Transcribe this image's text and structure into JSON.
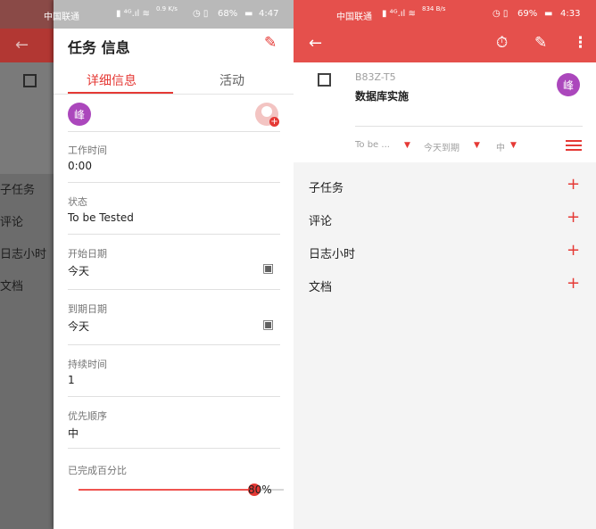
{
  "left": {
    "status_bar": {
      "carrier": "中国联通",
      "speed": "0.9 K/s",
      "battery": "68%",
      "time": "4:47"
    },
    "underlay_sections": [
      "子任务",
      "评论",
      "日志小时",
      "文档"
    ],
    "title": "任务 信息",
    "tabs": [
      {
        "label": "详细信息",
        "active": true
      },
      {
        "label": "活动",
        "active": false
      }
    ],
    "assignee_initial": "峰",
    "fields": [
      {
        "label": "工作时间",
        "value": "0:00"
      },
      {
        "label": "状态",
        "value": "To be Tested"
      },
      {
        "label": "开始日期",
        "value": "今天"
      },
      {
        "label": "到期日期",
        "value": "今天"
      },
      {
        "label": "持续时间",
        "value": "1"
      },
      {
        "label": "优先顺序",
        "value": "中"
      }
    ],
    "progress": {
      "label": "已完成百分比",
      "value_text": "80%",
      "value": 0.8
    }
  },
  "right": {
    "status_bar": {
      "carrier": "中国联通",
      "speed": "834 B/s",
      "battery": "69%",
      "time": "4:33"
    },
    "task": {
      "id": "B83Z-T5",
      "name": "数据库实施",
      "assignee_initial": "峰"
    },
    "filters": {
      "status": "To be ...",
      "due": "今天到期",
      "priority": "中"
    },
    "sections": [
      "子任务",
      "评论",
      "日志小时",
      "文档"
    ]
  },
  "colors": {
    "accent": "#e53935",
    "appbar": "#e5504c",
    "avatar": "#ab47bc"
  },
  "icons": {
    "back": "arrow-left-icon",
    "timer": "stopwatch-icon",
    "edit": "pencil-icon",
    "more": "more-vert-icon",
    "calendar": "calendar-icon",
    "add": "plus-icon",
    "add_person": "add-person-icon",
    "menu": "hamburger-icon"
  }
}
